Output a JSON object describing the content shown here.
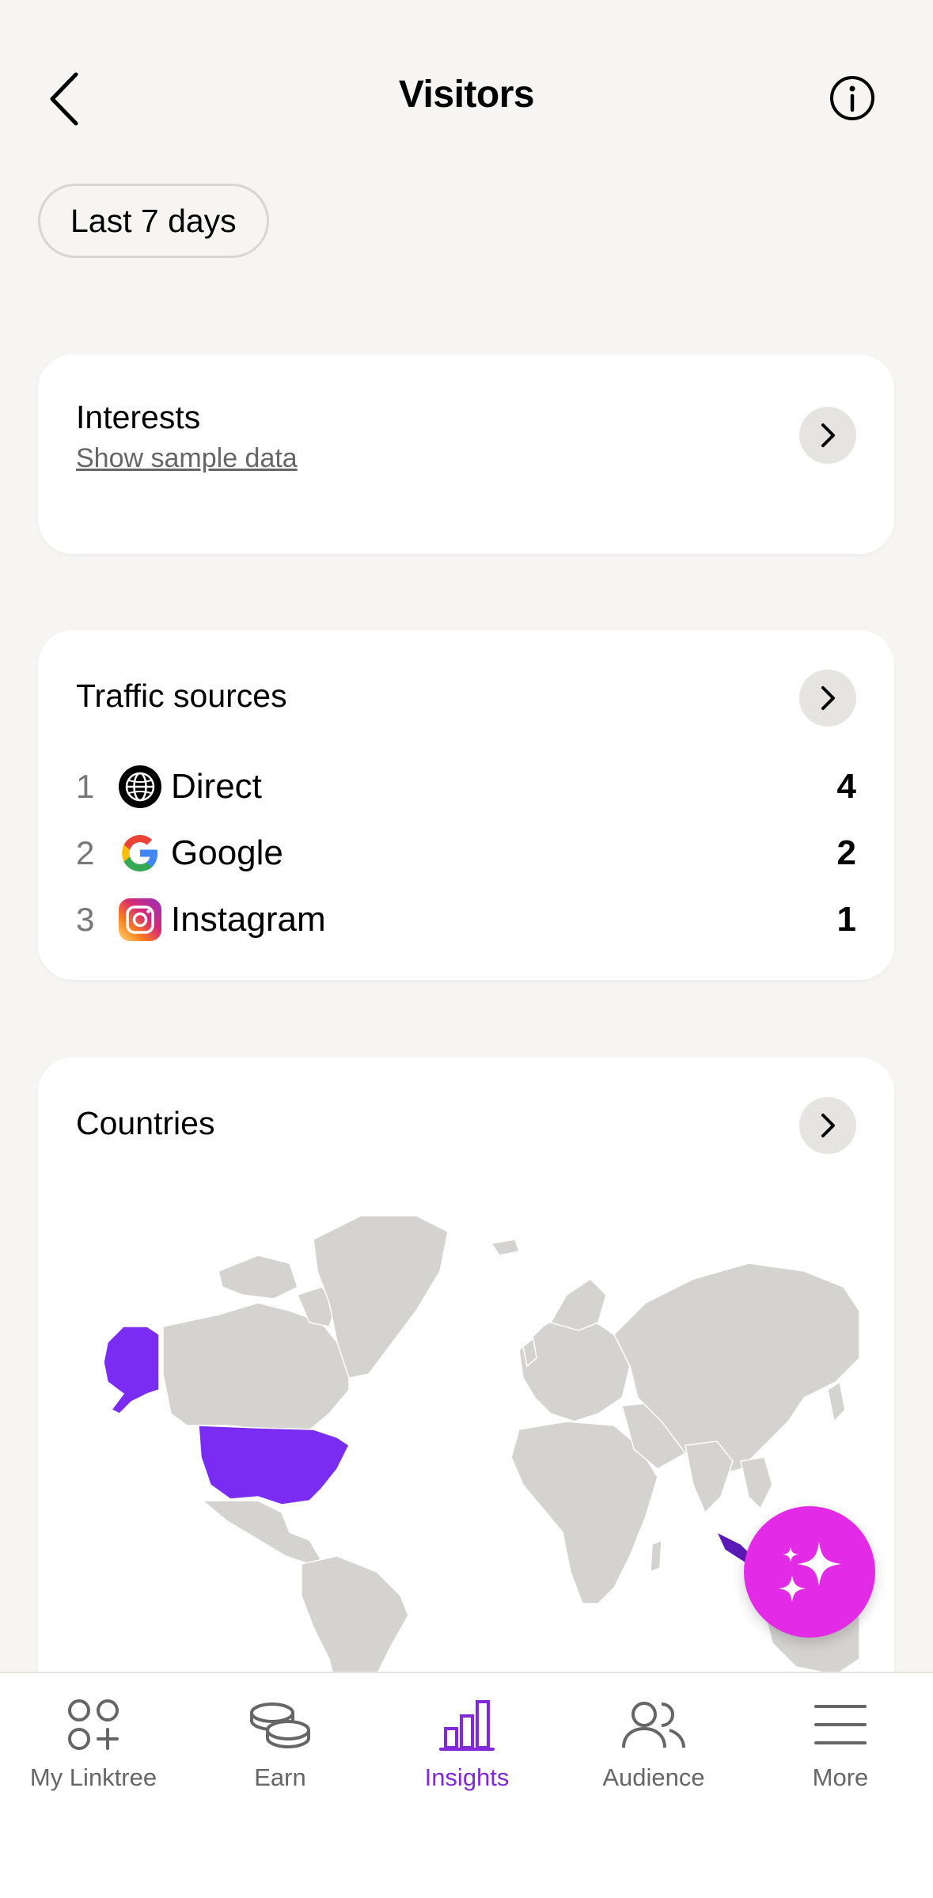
{
  "header": {
    "title": "Visitors"
  },
  "filter": {
    "label": "Last 7 days"
  },
  "interests": {
    "title": "Interests",
    "link": "Show sample data"
  },
  "traffic": {
    "title": "Traffic sources",
    "rows": [
      {
        "rank": "1",
        "icon": "globe-icon",
        "name": "Direct",
        "count": "4"
      },
      {
        "rank": "2",
        "icon": "google-icon",
        "name": "Google",
        "count": "2"
      },
      {
        "rank": "3",
        "icon": "instagram-icon",
        "name": "Instagram",
        "count": "1"
      }
    ]
  },
  "countries": {
    "title": "Countries",
    "highlighted": [
      "United States",
      "Indonesia"
    ]
  },
  "nav": {
    "items": [
      {
        "label": "My Linktree",
        "icon": "linktree-icon"
      },
      {
        "label": "Earn",
        "icon": "coins-icon"
      },
      {
        "label": "Insights",
        "icon": "bar-chart-icon",
        "active": true
      },
      {
        "label": "Audience",
        "icon": "people-icon"
      },
      {
        "label": "More",
        "icon": "menu-icon"
      }
    ]
  },
  "colors": {
    "accent": "#8129d9",
    "fab": "#e32ae6",
    "map_land": "#d5d3d0",
    "map_highlight": "#7b2cf3",
    "map_highlight_dark": "#5a1ab8"
  }
}
